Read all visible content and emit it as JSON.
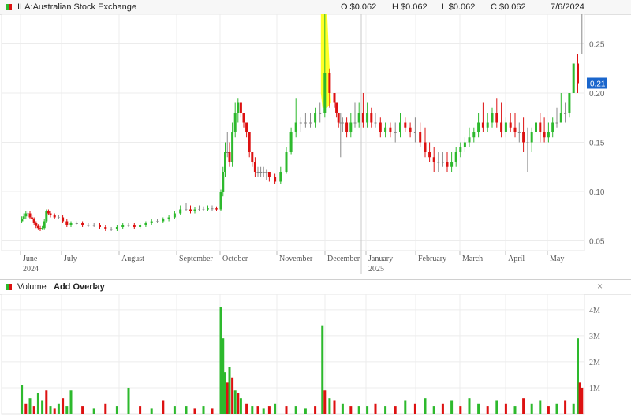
{
  "price_panel": {
    "symbol": "ILA:Australian Stock Exchange",
    "open": "O $0.062",
    "high": "H $0.062",
    "low": "L $0.062",
    "close": "C $0.062",
    "date": "7/6/2024",
    "last_price_label": "0.21",
    "colors": {
      "up": "#2db92d",
      "down": "#dd1111",
      "flat": "#888888",
      "highlight": "#ffff00",
      "price_tag": "#1a66cc"
    }
  },
  "volume_panel": {
    "title": "Volume",
    "add_overlay": "Add Overlay",
    "close_symbol": "×",
    "close_icon": "close-icon"
  },
  "chart_data": [
    {
      "type": "candlestick",
      "title": "ILA:Australian Stock Exchange",
      "y_tick_labels": [
        "0.25",
        "0.20",
        "0.15",
        "0.10",
        "0.05"
      ],
      "y_ticks": [
        0.25,
        0.2,
        0.15,
        0.1,
        0.05
      ],
      "ylim": [
        0.04,
        0.28
      ],
      "x_tick_labels": [
        {
          "label": "June",
          "sub": "2024",
          "x": 0
        },
        {
          "label": "July",
          "sub": "",
          "x": 1
        },
        {
          "label": "August",
          "sub": "",
          "x": 2
        },
        {
          "label": "September",
          "sub": "",
          "x": 3
        },
        {
          "label": "October",
          "sub": "",
          "x": 4
        },
        {
          "label": "November",
          "sub": "",
          "x": 5
        },
        {
          "label": "December",
          "sub": "",
          "x": 6
        },
        {
          "label": "January",
          "sub": "2025",
          "x": 7
        },
        {
          "label": "February",
          "sub": "",
          "x": 8
        },
        {
          "label": "March",
          "sub": "",
          "x": 9
        },
        {
          "label": "April",
          "sub": "",
          "x": 10
        },
        {
          "label": "May",
          "sub": "",
          "x": 11
        }
      ],
      "grid": true,
      "last_value": 0.21,
      "x": [
        -0.2,
        -0.15,
        -0.1,
        -0.05,
        0,
        0.05,
        0.1,
        0.15,
        0.2,
        0.25,
        0.3,
        0.35,
        0.4,
        0.45,
        0.5,
        0.6,
        0.7,
        0.8,
        0.9,
        1,
        1.1,
        1.2,
        1.3,
        1.4,
        1.5,
        1.6,
        1.7,
        1.8,
        1.9,
        2,
        2.1,
        2.2,
        2.3,
        2.4,
        2.5,
        2.6,
        2.7,
        2.8,
        2.9,
        3,
        3.1,
        3.2,
        3.3,
        3.4,
        3.5,
        3.6,
        3.7,
        3.8,
        3.85,
        3.9,
        3.95,
        4,
        4.05,
        4.1,
        4.15,
        4.2,
        4.25,
        4.3,
        4.35,
        4.4,
        4.45,
        4.5,
        4.55,
        4.6,
        4.65,
        4.7,
        4.8,
        4.9,
        5,
        5.1,
        5.2,
        5.3,
        5.4,
        5.5,
        5.6,
        5.7,
        5.8,
        5.9,
        6,
        6.05,
        6.1,
        6.15,
        6.2,
        6.3,
        6.4,
        6.5,
        6.6,
        6.7,
        6.8,
        6.9,
        7,
        7.1,
        7.2,
        7.3,
        7.4,
        7.5,
        7.6,
        7.7,
        7.8,
        7.9,
        8,
        8.1,
        8.2,
        8.3,
        8.4,
        8.5,
        8.6,
        8.7,
        8.8,
        8.9,
        9,
        9.1,
        9.2,
        9.3,
        9.4,
        9.5,
        9.6,
        9.7,
        9.8,
        9.9,
        10,
        10.1,
        10.2,
        10.3,
        10.4,
        10.5,
        10.6,
        10.7,
        10.8,
        10.9,
        11,
        11.1,
        11.2,
        11.3,
        11.4,
        11.5,
        11.6
      ],
      "open": [
        0.07,
        0.072,
        0.075,
        0.078,
        0.078,
        0.074,
        0.072,
        0.068,
        0.065,
        0.063,
        0.062,
        0.063,
        0.07,
        0.08,
        0.078,
        0.076,
        0.074,
        0.074,
        0.07,
        0.066,
        0.068,
        0.068,
        0.066,
        0.066,
        0.066,
        0.064,
        0.062,
        0.062,
        0.064,
        0.066,
        0.066,
        0.064,
        0.066,
        0.068,
        0.07,
        0.07,
        0.072,
        0.074,
        0.078,
        0.082,
        0.082,
        0.08,
        0.082,
        0.082,
        0.082,
        0.083,
        0.083,
        0.082,
        0.1,
        0.12,
        0.14,
        0.14,
        0.13,
        0.16,
        0.18,
        0.19,
        0.18,
        0.17,
        0.16,
        0.14,
        0.13,
        0.12,
        0.12,
        0.12,
        0.12,
        0.12,
        0.115,
        0.11,
        0.12,
        0.14,
        0.16,
        0.17,
        0.17,
        0.17,
        0.17,
        0.18,
        0.18,
        0.22,
        0.2,
        0.19,
        0.18,
        0.17,
        0.17,
        0.17,
        0.16,
        0.17,
        0.17,
        0.18,
        0.17,
        0.18,
        0.17,
        0.17,
        0.16,
        0.165,
        0.16,
        0.16,
        0.17,
        0.165,
        0.16,
        0.16,
        0.15,
        0.14,
        0.135,
        0.13,
        0.13,
        0.13,
        0.125,
        0.13,
        0.14,
        0.145,
        0.15,
        0.155,
        0.16,
        0.17,
        0.165,
        0.17,
        0.18,
        0.17,
        0.16,
        0.17,
        0.165,
        0.16,
        0.16,
        0.15,
        0.15,
        0.16,
        0.17,
        0.16,
        0.155,
        0.16,
        0.17,
        0.17,
        0.18,
        0.18,
        0.2,
        0.23
      ],
      "close": [
        0.072,
        0.075,
        0.078,
        0.078,
        0.074,
        0.072,
        0.068,
        0.065,
        0.063,
        0.062,
        0.063,
        0.07,
        0.08,
        0.078,
        0.076,
        0.074,
        0.074,
        0.07,
        0.066,
        0.068,
        0.068,
        0.066,
        0.066,
        0.066,
        0.064,
        0.062,
        0.062,
        0.064,
        0.066,
        0.066,
        0.064,
        0.066,
        0.068,
        0.07,
        0.07,
        0.072,
        0.074,
        0.078,
        0.082,
        0.082,
        0.08,
        0.082,
        0.082,
        0.082,
        0.083,
        0.083,
        0.082,
        0.1,
        0.12,
        0.14,
        0.14,
        0.13,
        0.16,
        0.18,
        0.19,
        0.18,
        0.17,
        0.16,
        0.14,
        0.13,
        0.12,
        0.12,
        0.12,
        0.12,
        0.12,
        0.115,
        0.11,
        0.12,
        0.14,
        0.16,
        0.17,
        0.17,
        0.17,
        0.17,
        0.18,
        0.18,
        0.22,
        0.2,
        0.19,
        0.18,
        0.17,
        0.17,
        0.17,
        0.16,
        0.17,
        0.17,
        0.18,
        0.17,
        0.18,
        0.17,
        0.17,
        0.16,
        0.165,
        0.16,
        0.16,
        0.17,
        0.165,
        0.16,
        0.16,
        0.15,
        0.14,
        0.135,
        0.13,
        0.13,
        0.13,
        0.125,
        0.13,
        0.14,
        0.145,
        0.15,
        0.155,
        0.16,
        0.17,
        0.165,
        0.17,
        0.18,
        0.17,
        0.16,
        0.17,
        0.165,
        0.16,
        0.16,
        0.15,
        0.15,
        0.16,
        0.17,
        0.16,
        0.155,
        0.16,
        0.17,
        0.17,
        0.18,
        0.18,
        0.2,
        0.23,
        0.21
      ],
      "high": [
        0.075,
        0.078,
        0.08,
        0.08,
        0.08,
        0.076,
        0.074,
        0.07,
        0.067,
        0.065,
        0.065,
        0.072,
        0.082,
        0.082,
        0.08,
        0.078,
        0.076,
        0.076,
        0.072,
        0.07,
        0.07,
        0.07,
        0.068,
        0.068,
        0.068,
        0.066,
        0.064,
        0.066,
        0.068,
        0.068,
        0.068,
        0.068,
        0.07,
        0.072,
        0.072,
        0.074,
        0.076,
        0.08,
        0.086,
        0.088,
        0.086,
        0.084,
        0.086,
        0.085,
        0.086,
        0.086,
        0.085,
        0.102,
        0.125,
        0.15,
        0.16,
        0.15,
        0.17,
        0.19,
        0.195,
        0.19,
        0.18,
        0.17,
        0.16,
        0.14,
        0.135,
        0.125,
        0.125,
        0.125,
        0.122,
        0.12,
        0.118,
        0.125,
        0.145,
        0.165,
        0.195,
        0.175,
        0.18,
        0.18,
        0.185,
        0.19,
        0.28,
        0.225,
        0.2,
        0.19,
        0.18,
        0.18,
        0.175,
        0.175,
        0.18,
        0.19,
        0.19,
        0.2,
        0.19,
        0.185,
        0.18,
        0.175,
        0.17,
        0.17,
        0.17,
        0.18,
        0.175,
        0.17,
        0.175,
        0.17,
        0.165,
        0.15,
        0.145,
        0.14,
        0.14,
        0.14,
        0.14,
        0.145,
        0.15,
        0.155,
        0.165,
        0.165,
        0.18,
        0.19,
        0.18,
        0.185,
        0.195,
        0.19,
        0.175,
        0.18,
        0.18,
        0.17,
        0.175,
        0.165,
        0.165,
        0.175,
        0.18,
        0.175,
        0.17,
        0.175,
        0.185,
        0.2,
        0.19,
        0.19,
        0.21,
        0.24,
        0.24
      ],
      "low": [
        0.068,
        0.07,
        0.072,
        0.075,
        0.072,
        0.07,
        0.066,
        0.063,
        0.061,
        0.06,
        0.061,
        0.061,
        0.068,
        0.076,
        0.074,
        0.072,
        0.072,
        0.068,
        0.064,
        0.064,
        0.066,
        0.064,
        0.064,
        0.064,
        0.062,
        0.06,
        0.06,
        0.06,
        0.062,
        0.064,
        0.062,
        0.062,
        0.064,
        0.066,
        0.068,
        0.068,
        0.07,
        0.072,
        0.076,
        0.08,
        0.078,
        0.078,
        0.08,
        0.08,
        0.08,
        0.08,
        0.08,
        0.08,
        0.095,
        0.115,
        0.135,
        0.125,
        0.125,
        0.155,
        0.17,
        0.175,
        0.165,
        0.155,
        0.135,
        0.125,
        0.115,
        0.115,
        0.115,
        0.115,
        0.112,
        0.11,
        0.108,
        0.108,
        0.118,
        0.138,
        0.155,
        0.16,
        0.165,
        0.165,
        0.165,
        0.17,
        0.175,
        0.185,
        0.185,
        0.175,
        0.165,
        0.135,
        0.16,
        0.155,
        0.155,
        0.165,
        0.165,
        0.165,
        0.165,
        0.165,
        0.165,
        0.155,
        0.155,
        0.155,
        0.15,
        0.155,
        0.16,
        0.155,
        0.15,
        0.145,
        0.135,
        0.13,
        0.12,
        0.12,
        0.125,
        0.12,
        0.12,
        0.125,
        0.135,
        0.14,
        0.145,
        0.15,
        0.155,
        0.16,
        0.16,
        0.165,
        0.165,
        0.155,
        0.155,
        0.16,
        0.155,
        0.15,
        0.14,
        0.12,
        0.14,
        0.15,
        0.15,
        0.15,
        0.15,
        0.155,
        0.165,
        0.17,
        0.17,
        0.175,
        0.2,
        0.2
      ]
    },
    {
      "type": "bar",
      "title": "Volume",
      "y_tick_labels": [
        "4M",
        "3M",
        "2M",
        "1M"
      ],
      "y_ticks": [
        4,
        3,
        2,
        1
      ],
      "ylim": [
        0,
        4.6
      ],
      "units": "M",
      "x": [
        -0.2,
        -0.1,
        0,
        0.1,
        0.2,
        0.3,
        0.4,
        0.5,
        0.6,
        0.7,
        0.8,
        0.9,
        1,
        1.2,
        1.4,
        1.6,
        1.8,
        2,
        2.2,
        2.4,
        2.6,
        2.8,
        3,
        3.2,
        3.4,
        3.6,
        3.8,
        3.85,
        3.9,
        3.95,
        4,
        4.05,
        4.1,
        4.15,
        4.2,
        4.3,
        4.4,
        4.5,
        4.6,
        4.7,
        4.8,
        5,
        5.2,
        5.4,
        5.6,
        5.75,
        5.8,
        5.9,
        6,
        6.2,
        6.4,
        6.6,
        6.8,
        7,
        7.2,
        7.4,
        7.6,
        7.8,
        8,
        8.2,
        8.4,
        8.6,
        8.8,
        9,
        9.2,
        9.4,
        9.6,
        9.8,
        10,
        10.2,
        10.4,
        10.6,
        10.8,
        11,
        11.2,
        11.4,
        11.5,
        11.55,
        11.6
      ],
      "values": [
        1.1,
        0.4,
        0.6,
        0.3,
        0.8,
        0.5,
        0.9,
        0.3,
        0.2,
        0.4,
        0.6,
        0.3,
        0.9,
        0.3,
        0.2,
        0.4,
        0.3,
        1.0,
        0.3,
        0.2,
        0.5,
        0.3,
        0.3,
        0.2,
        0.3,
        0.2,
        4.1,
        2.9,
        1.6,
        1.2,
        1.8,
        1.4,
        0.9,
        0.8,
        0.6,
        0.4,
        0.3,
        0.3,
        0.2,
        0.3,
        0.4,
        0.3,
        0.3,
        0.2,
        0.3,
        3.4,
        0.9,
        0.6,
        0.5,
        0.4,
        0.3,
        0.3,
        0.3,
        0.4,
        0.3,
        0.3,
        0.5,
        0.4,
        0.6,
        0.3,
        0.4,
        0.5,
        0.3,
        0.6,
        0.4,
        0.3,
        0.5,
        0.4,
        0.3,
        0.6,
        0.4,
        0.5,
        0.3,
        0.4,
        0.5,
        0.4,
        2.9,
        1.2,
        1.0
      ],
      "up": [
        true,
        false,
        true,
        false,
        true,
        true,
        false,
        true,
        false,
        true,
        false,
        true,
        true,
        false,
        true,
        false,
        true,
        true,
        false,
        true,
        false,
        true,
        true,
        false,
        true,
        false,
        true,
        true,
        true,
        false,
        true,
        false,
        true,
        false,
        true,
        false,
        true,
        false,
        true,
        false,
        true,
        false,
        true,
        true,
        false,
        true,
        false,
        true,
        false,
        true,
        false,
        true,
        true,
        false,
        true,
        false,
        true,
        false,
        true,
        true,
        false,
        true,
        false,
        true,
        true,
        false,
        true,
        false,
        true,
        false,
        true,
        true,
        false,
        true,
        false,
        true,
        true,
        false,
        false
      ]
    }
  ]
}
